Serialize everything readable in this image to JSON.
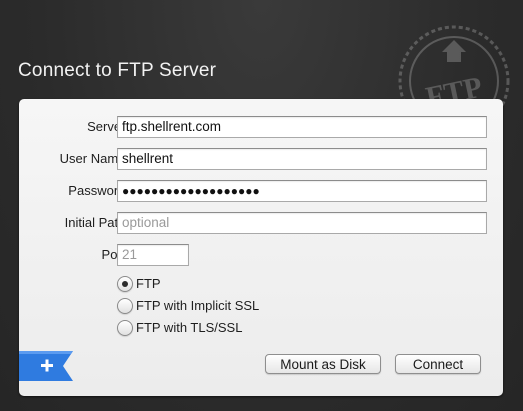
{
  "dialog": {
    "title": "Connect to FTP Server",
    "stamp_text": "FTP"
  },
  "form": {
    "server": {
      "label": "Server:",
      "value": "ftp.shellrent.com"
    },
    "username": {
      "label": "User Name:",
      "value": "shellrent"
    },
    "password": {
      "label": "Password:",
      "value": "●●●●●●●●●●●●●●●●●●●"
    },
    "initial_path": {
      "label": "Initial Path:",
      "placeholder": "optional"
    },
    "port": {
      "label": "Port:",
      "placeholder": "21"
    }
  },
  "protocol": {
    "options": [
      {
        "label": "FTP",
        "checked": true
      },
      {
        "label": "FTP with Implicit SSL",
        "checked": false
      },
      {
        "label": "FTP with TLS/SSL",
        "checked": false
      }
    ]
  },
  "buttons": {
    "mount": "Mount as Disk",
    "connect": "Connect",
    "add_icon": "plus-icon"
  },
  "colors": {
    "accent_blue": "#2f7be0",
    "background": "#2c2c2c",
    "panel": "#f0f0f0"
  }
}
